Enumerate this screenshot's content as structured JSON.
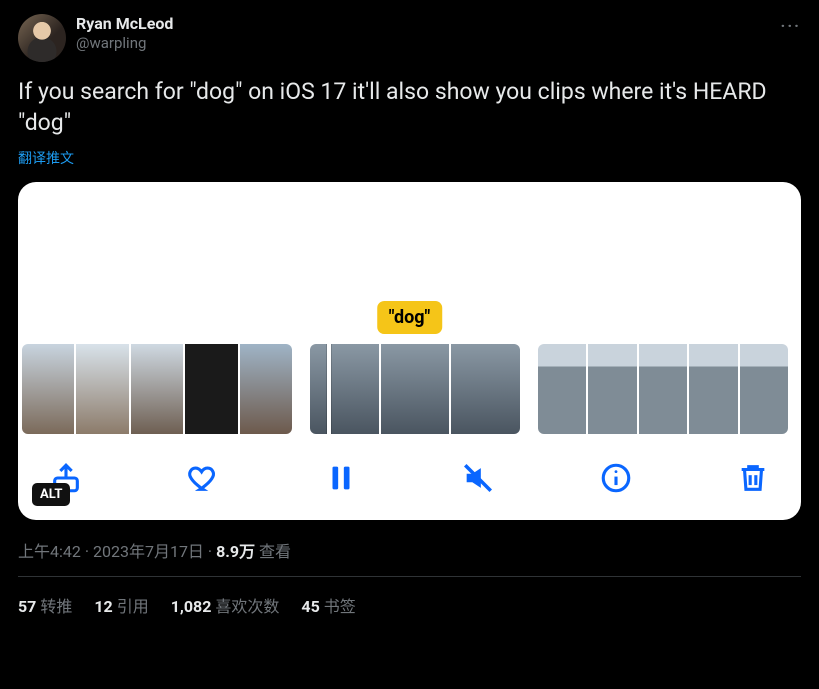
{
  "user": {
    "display_name": "Ryan McLeod",
    "handle": "@warpling"
  },
  "tweet": {
    "text": "If you search for \"dog\" on iOS 17 it'll also show you clips where it's HEARD \"dog\"",
    "translate_label": "翻译推文",
    "badge_text": "\"dog\"",
    "alt_label": "ALT"
  },
  "meta": {
    "time": "上午4:42",
    "date": "2023年7月17日",
    "views_value": "8.9万",
    "views_label": "查看",
    "separator": " · "
  },
  "stats": {
    "retweets_count": "57",
    "retweets_label": "转推",
    "quotes_count": "12",
    "quotes_label": "引用",
    "likes_count": "1,082",
    "likes_label": "喜欢次数",
    "bookmarks_count": "45",
    "bookmarks_label": "书签"
  },
  "more_label": "···"
}
